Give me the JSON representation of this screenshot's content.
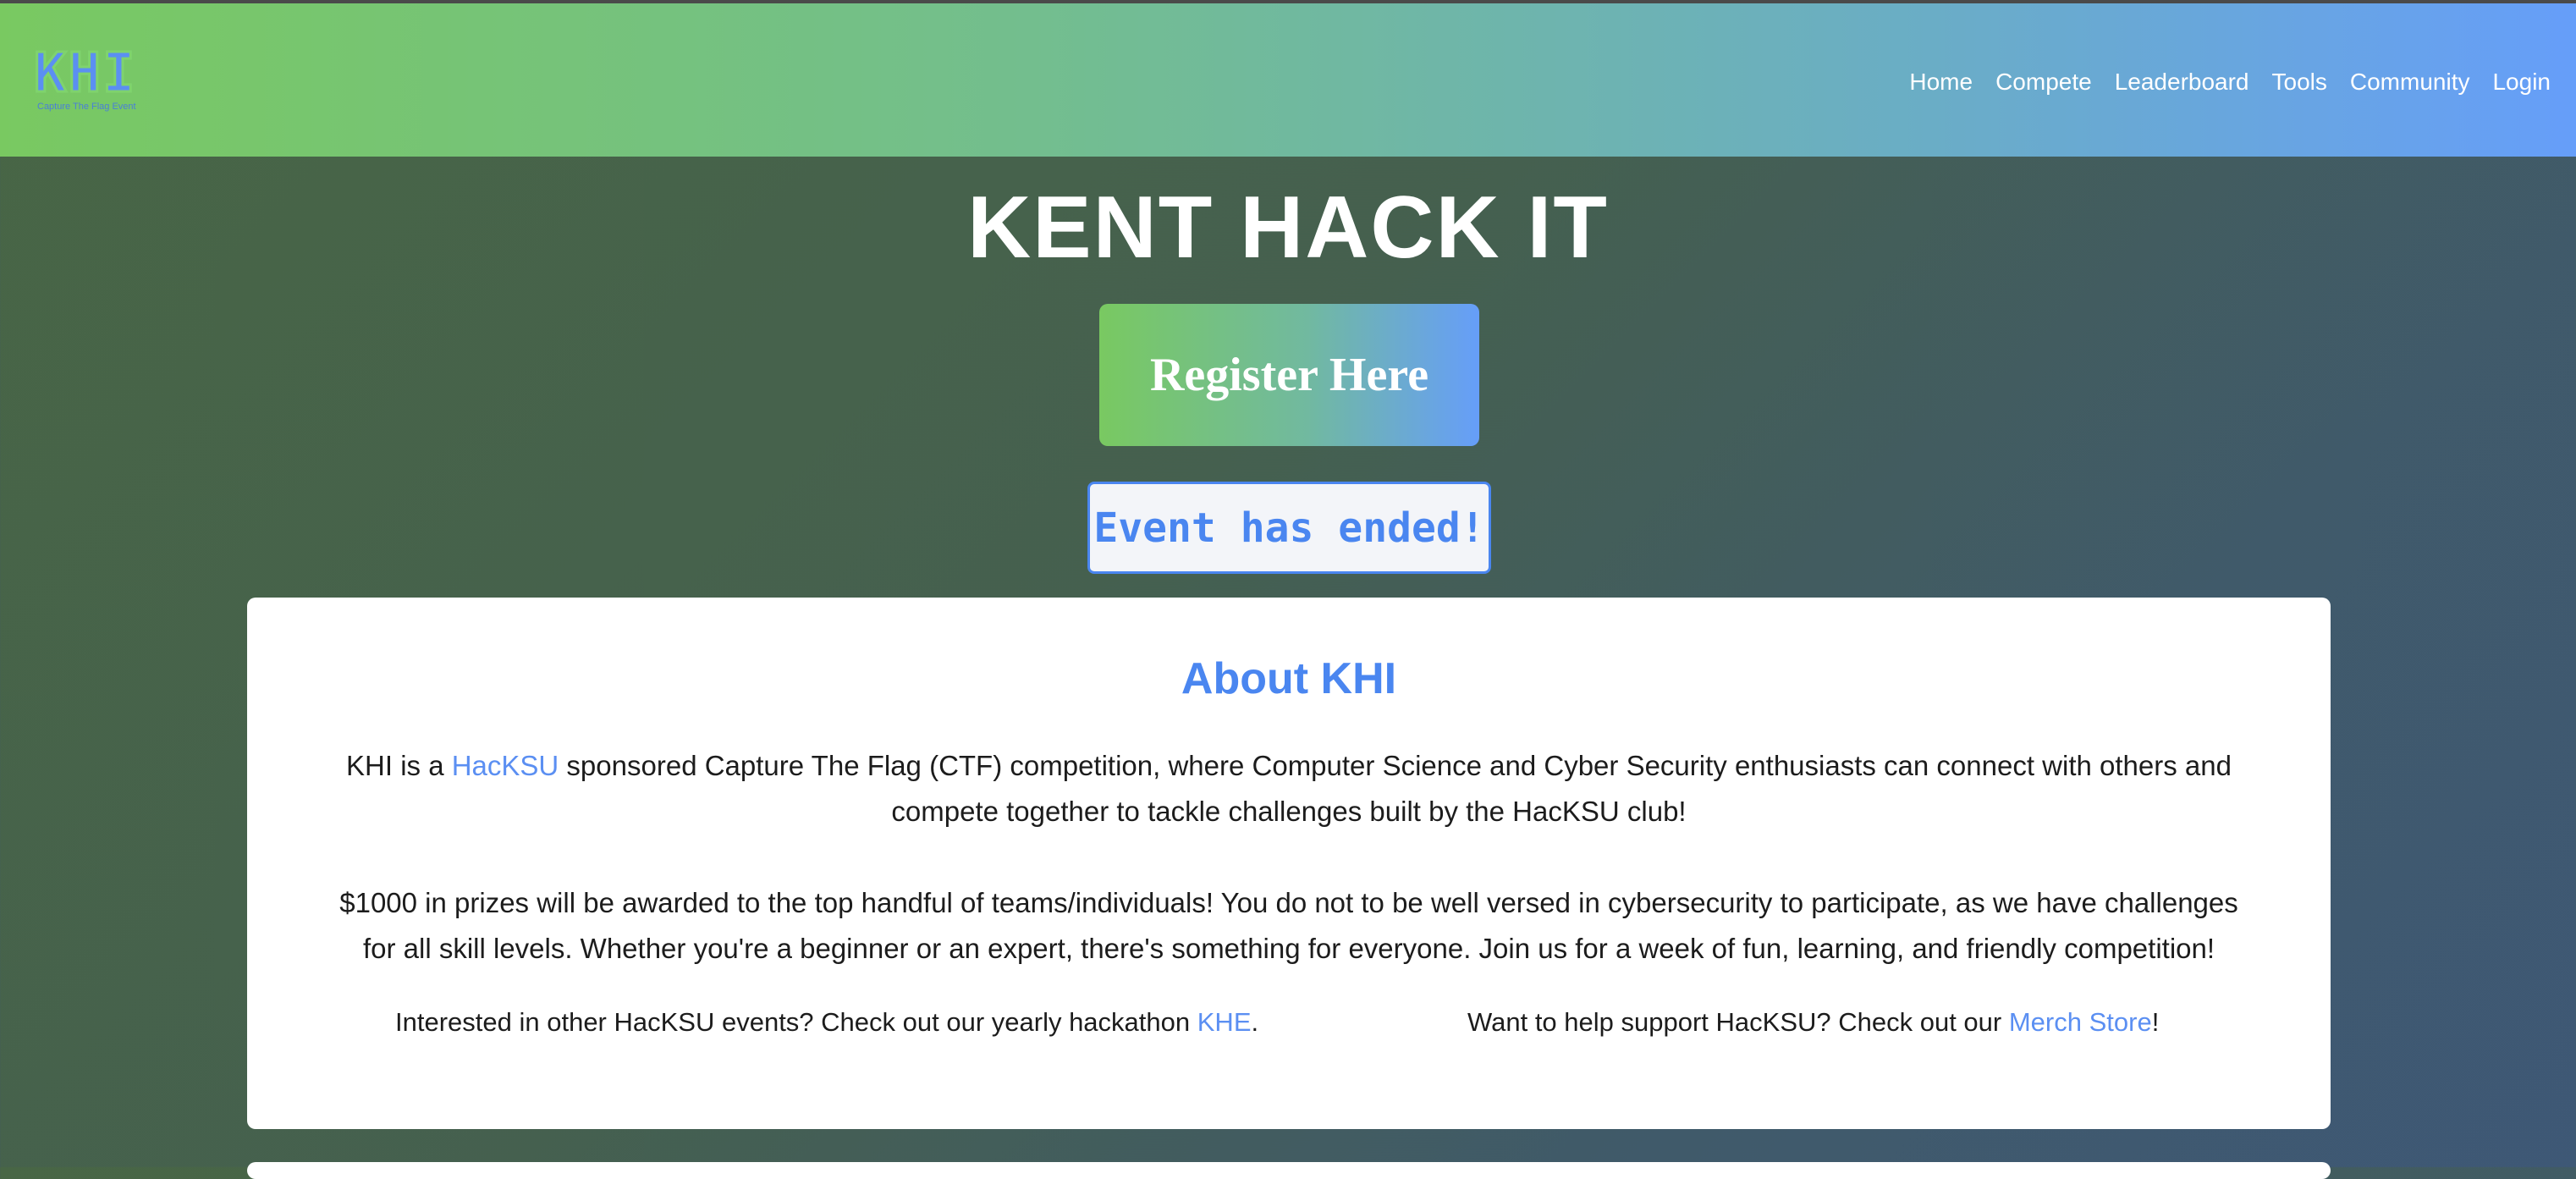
{
  "brand": {
    "logo_text": "KHI",
    "logo_subtitle": "Capture The Flag Event"
  },
  "nav": {
    "items": [
      "Home",
      "Compete",
      "Leaderboard",
      "Tools",
      "Community",
      "Login"
    ]
  },
  "hero": {
    "title": "KENT HACK IT",
    "register_label": "Register Here",
    "status_text": "Event has ended!"
  },
  "about": {
    "title": "About KHI",
    "p1_before": "KHI is a ",
    "p1_link": "HacKSU",
    "p1_after": " sponsored Capture The Flag (CTF) competition, where Computer Science and Cyber Security enthusiasts can connect with others and compete together to tackle challenges built by the HacKSU club!",
    "p2": "$1000 in prizes will be awarded to the top handful of teams/individuals! You do not to be well versed in cybersecurity to participate, as we have challenges for all skill levels. Whether you're a beginner or an expert, there's something for everyone. Join us for a week of fun, learning, and friendly competition!",
    "events_before": "Interested in other HacKSU events? Check out our yearly hackathon ",
    "events_link": "KHE",
    "events_after": ".",
    "merch_before": "Want to help support HacKSU? Check out our ",
    "merch_link": "Merch Store",
    "merch_after": "!"
  },
  "colors": {
    "accent_blue": "#4a86f0",
    "nav_green": "#79c961",
    "nav_blue": "#669ef9"
  }
}
